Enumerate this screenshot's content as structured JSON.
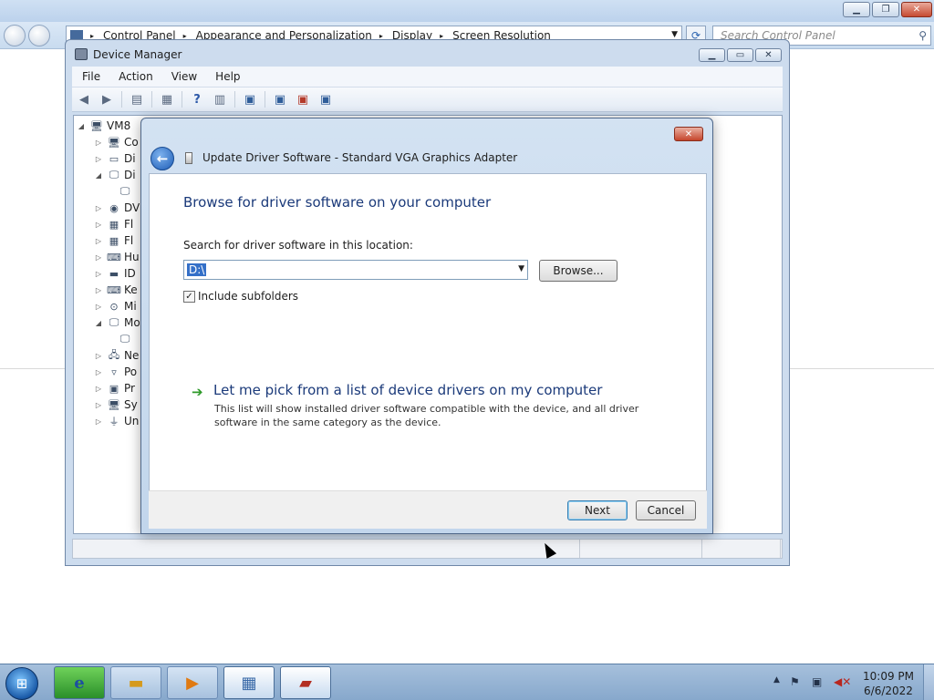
{
  "control_panel": {
    "breadcrumb": [
      "Control Panel",
      "Appearance and Personalization",
      "Display",
      "Screen Resolution"
    ],
    "search_placeholder": "Search Control Panel"
  },
  "device_manager": {
    "title": "Device Manager",
    "menu": [
      "File",
      "Action",
      "View",
      "Help"
    ],
    "tree": [
      {
        "label": "VM8",
        "expander": "◢",
        "icon": "computer-icon"
      },
      {
        "label": "Co",
        "expander": "▷",
        "icon": "computer-icon"
      },
      {
        "label": "Di",
        "expander": "▷",
        "icon": "disk-drive-icon"
      },
      {
        "label": "Di",
        "expander": "◢",
        "icon": "display-adapter-icon"
      },
      {
        "label": "",
        "expander": "",
        "icon": "display-adapter-child-icon"
      },
      {
        "label": "DV",
        "expander": "▷",
        "icon": "dvd-drive-icon"
      },
      {
        "label": "Fl",
        "expander": "▷",
        "icon": "floppy-controller-icon"
      },
      {
        "label": "Fl",
        "expander": "▷",
        "icon": "floppy-drive-icon"
      },
      {
        "label": "Hu",
        "expander": "▷",
        "icon": "hid-icon"
      },
      {
        "label": "ID",
        "expander": "▷",
        "icon": "ide-controller-icon"
      },
      {
        "label": "Ke",
        "expander": "▷",
        "icon": "keyboard-icon"
      },
      {
        "label": "Mi",
        "expander": "▷",
        "icon": "mouse-icon"
      },
      {
        "label": "Mo",
        "expander": "◢",
        "icon": "monitor-icon"
      },
      {
        "label": "",
        "expander": "",
        "icon": "monitor-child-icon"
      },
      {
        "label": "Ne",
        "expander": "▷",
        "icon": "network-adapter-icon"
      },
      {
        "label": "Po",
        "expander": "▷",
        "icon": "port-icon"
      },
      {
        "label": "Pr",
        "expander": "▷",
        "icon": "processor-icon"
      },
      {
        "label": "Sy",
        "expander": "▷",
        "icon": "system-device-icon"
      },
      {
        "label": "Un",
        "expander": "▷",
        "icon": "usb-controller-icon"
      }
    ]
  },
  "dialog": {
    "title": "Update Driver Software - Standard VGA Graphics Adapter",
    "heading": "Browse for driver software on your computer",
    "location_label": "Search for driver software in this location:",
    "location_value": "D:\\",
    "browse_label": "Browse...",
    "include_subfolders_label": "Include subfolders",
    "include_subfolders_checked": true,
    "pick_title": "Let me pick from a list of device drivers on my computer",
    "pick_description": "This list will show installed driver software compatible with the device, and all driver software in the same category as the device.",
    "next_label": "Next",
    "cancel_label": "Cancel"
  },
  "taskbar": {
    "items": [
      "start-button",
      "internet-explorer",
      "windows-explorer",
      "media-player",
      "control-panel",
      "device-manager-toolbox"
    ],
    "clock_time": "10:09 PM",
    "clock_date": "6/6/2022"
  }
}
